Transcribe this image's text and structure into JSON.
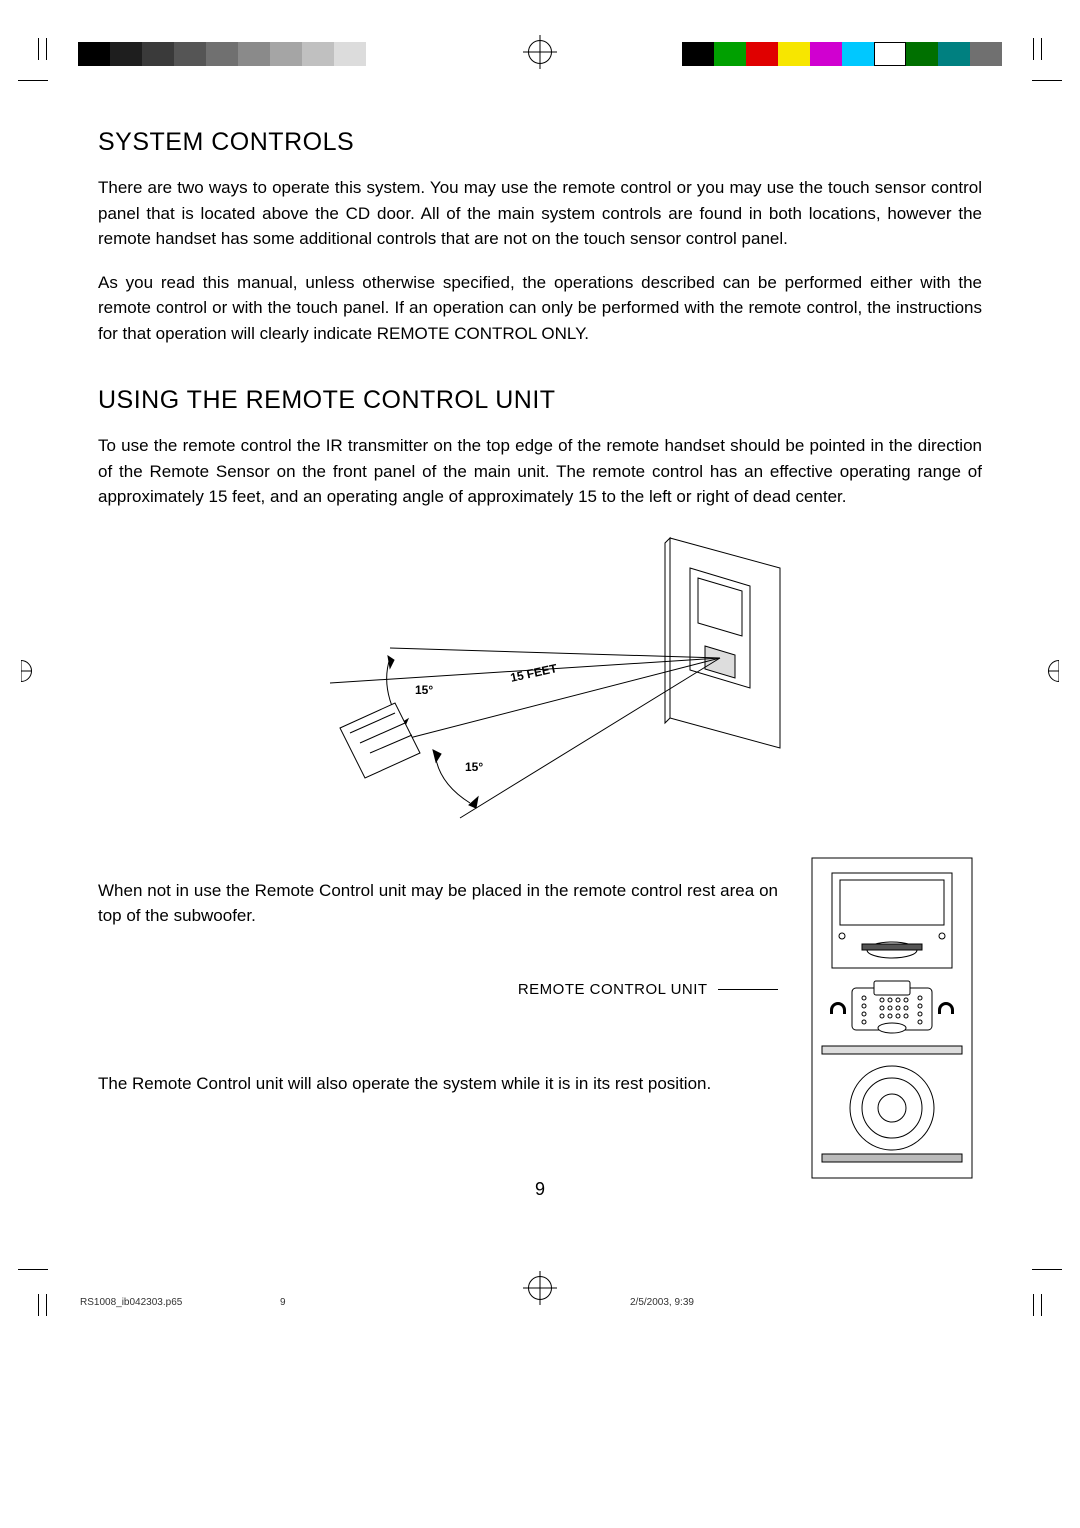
{
  "header_bars": {
    "left_colors": [
      "#000000",
      "#1e1e1e",
      "#3a3a3a",
      "#555555",
      "#707070",
      "#8a8a8a",
      "#a5a5a5",
      "#c0c0c0",
      "#dcdcdc"
    ],
    "right_colors": [
      "#000000",
      "#00a000",
      "#e00000",
      "#f7e600",
      "#d000d0",
      "#00c8ff",
      "#ffffff",
      "#007000",
      "#008080",
      "#707070"
    ]
  },
  "sections": [
    {
      "heading": "SYSTEM CONTROLS",
      "paragraphs": [
        "There are two ways to operate this system. You may use the remote control or you may use the touch sensor control panel that is located above the CD door. All of the main system controls are found in both locations, however the remote handset has some additional controls that are not on the touch sensor control panel.",
        "As you read this manual, unless otherwise specified, the operations described can be performed either with the remote control or with the touch panel. If an operation can only be performed with the remote control, the instructions for that operation will clearly indicate REMOTE CONTROL ONLY."
      ]
    },
    {
      "heading": "USING THE REMOTE CONTROL UNIT",
      "paragraphs": [
        "To use the remote control the IR transmitter on the top edge of the remote handset should be pointed in the direction of the Remote Sensor on the front panel of the main unit. The remote control has an effective operating range of approximately 15 feet, and an operating angle of approximately 15  to the left or right of dead center."
      ]
    }
  ],
  "diagram_labels": {
    "angle_upper": "15°",
    "angle_lower": "15°",
    "distance": "15 FEET"
  },
  "rest_para_1": "When not in use the Remote Control unit may be placed in the remote control rest area on top of the subwoofer.",
  "callout_label": "REMOTE CONTROL UNIT",
  "rest_para_2": "The Remote Control unit will also operate the system while it is in its rest position.",
  "page_number": "9",
  "footer": {
    "file": "RS1008_ib042303.p65",
    "page": "9",
    "timestamp": "2/5/2003, 9:39"
  }
}
